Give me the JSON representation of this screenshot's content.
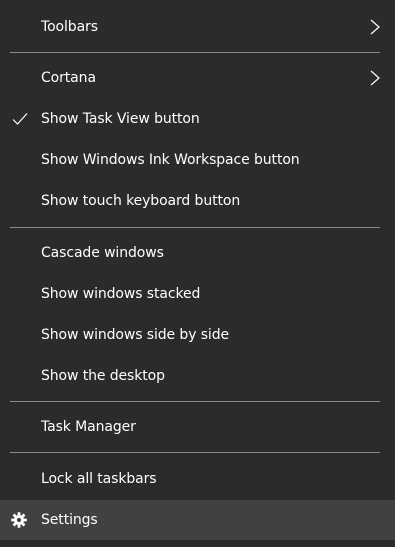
{
  "menu": {
    "items": [
      {
        "label": "Toolbars",
        "submenu": true
      },
      {
        "label": "Cortana",
        "submenu": true
      },
      {
        "label": "Show Task View button",
        "checked": true
      },
      {
        "label": "Show Windows Ink Workspace button"
      },
      {
        "label": "Show touch keyboard button"
      },
      {
        "label": "Cascade windows"
      },
      {
        "label": "Show windows stacked"
      },
      {
        "label": "Show windows side by side"
      },
      {
        "label": "Show the desktop"
      },
      {
        "label": "Task Manager"
      },
      {
        "label": "Lock all taskbars"
      },
      {
        "label": "Settings",
        "icon": "gear-icon",
        "highlighted": true
      }
    ]
  },
  "colors": {
    "background": "#2b2b2b",
    "text": "#ffffff",
    "divider": "#8b8b8b",
    "highlight": "#414141"
  }
}
